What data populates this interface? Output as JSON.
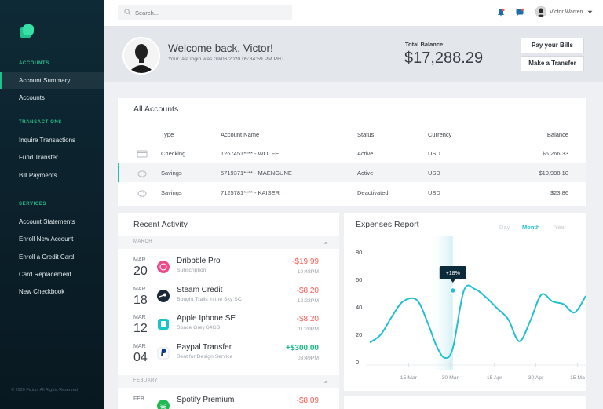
{
  "topbar": {
    "search_placeholder": "Search...",
    "user_name": "Victor Warren"
  },
  "sidebar": {
    "sections": [
      {
        "label": "ACCOUNTS",
        "items": [
          "Account Summary",
          "Accounts"
        ]
      },
      {
        "label": "TRANSACTIONS",
        "items": [
          "Inquire Transactions",
          "Fund Transfer",
          "Bill Payments"
        ]
      },
      {
        "label": "SERVICES",
        "items": [
          "Account Statements",
          "Enroll New Account",
          "Enroll a Credit Card",
          "Card Replacement",
          "New Checkbook"
        ]
      }
    ],
    "active_item": "Account Summary",
    "copyright": "© 2020 Fixico. All Rights Reserved"
  },
  "welcome": {
    "title": "Welcome back, Victor!",
    "last_login": "Your last login was 09/06/2020 05:34:59 PM PHT",
    "balance_label": "Total Balance",
    "balance_value": "$17,288.29",
    "buttons": [
      "Pay your Bills",
      "Make a Transfer"
    ]
  },
  "accounts": {
    "title": "All Accounts",
    "columns": [
      "Type",
      "Account Name",
      "Status",
      "Currency",
      "Balance"
    ],
    "rows": [
      {
        "type": "Checking",
        "name": "1267451**** - WOLFE",
        "status": "Active",
        "currency": "USD",
        "balance": "$6,266.33",
        "icon": "card-icon"
      },
      {
        "type": "Savings",
        "name": "5719371**** - MAENGUNE",
        "status": "Active",
        "currency": "USD",
        "balance": "$10,998.10",
        "icon": "piggy-bank-icon",
        "highlighted": true
      },
      {
        "type": "Savings",
        "name": "7125781**** - KAISER",
        "status": "Deactivated",
        "currency": "USD",
        "balance": "$23.86",
        "icon": "piggy-bank-icon"
      }
    ]
  },
  "activity": {
    "title": "Recent Activity",
    "groups": [
      {
        "month": "MARCH",
        "items": [
          {
            "mon": "MAR",
            "day": "20",
            "title": "Dribbble Pro",
            "sub": "Subscription",
            "amount": "-$19.99",
            "time": "10:48PM",
            "logo": "dribbble-logo",
            "color": "#ea4c89"
          },
          {
            "mon": "MAR",
            "day": "18",
            "title": "Steam Credit",
            "sub": "Bought Trails in the Sky SC",
            "amount": "-$8.20",
            "time": "12:23PM",
            "logo": "steam-logo",
            "color": "#1b2838"
          },
          {
            "mon": "MAR",
            "day": "12",
            "title": "Apple Iphone SE",
            "sub": "Space Grey 64GB",
            "amount": "-$8.20",
            "time": "11:20PM",
            "logo": "apple-store-logo",
            "color": "#16c6c6"
          },
          {
            "mon": "MAR",
            "day": "04",
            "title": "Paypal Transfer",
            "sub": "Sent for Design Service",
            "amount": "+$300.00",
            "time": "03:49PM",
            "logo": "paypal-logo",
            "color": "#0a3a8f",
            "positive": true
          }
        ]
      },
      {
        "month": "FEBUARY",
        "items": [
          {
            "mon": "FEB",
            "day": "",
            "title": "Spotify Premium",
            "sub": "",
            "amount": "-$8.09",
            "time": "",
            "logo": "spotify-logo",
            "color": "#1db954"
          }
        ]
      }
    ]
  },
  "expenses": {
    "title": "Expenses Report",
    "tabs": [
      "Day",
      "Month",
      "Year"
    ],
    "active_tab": "Month",
    "tooltip": "+18%"
  },
  "chart_data": {
    "type": "line",
    "title": "Expenses Report",
    "x_ticks": [
      "15 Mar",
      "30 Mar",
      "15 Apr",
      "30 Apr",
      "15 Ma"
    ],
    "y_ticks": [
      0,
      20,
      40,
      60,
      80
    ],
    "ylim": [
      0,
      80
    ],
    "series": [
      {
        "x": [
          "01 Mar",
          "05 Mar",
          "09 Mar",
          "13 Mar",
          "18 Mar",
          "22 Mar",
          "25 Mar",
          "28 Mar",
          "31 Mar",
          "04 Apr",
          "08 Apr",
          "12 Apr",
          "16 Apr",
          "20 Apr",
          "24 Apr",
          "28 Apr",
          "02 May",
          "06 May",
          "10 May",
          "14 May",
          "18 May"
        ],
        "y": [
          14,
          20,
          33,
          44,
          45,
          28,
          12,
          3,
          10,
          52,
          53,
          47,
          39,
          31,
          15,
          30,
          49,
          44,
          42,
          36,
          48
        ],
        "color": "#22c0d0"
      }
    ],
    "highlight_region": [
      "22 Mar",
      "31 Mar"
    ],
    "annotation": {
      "x": "31 Mar",
      "y": 52,
      "label": "+18%"
    },
    "grid": true
  }
}
